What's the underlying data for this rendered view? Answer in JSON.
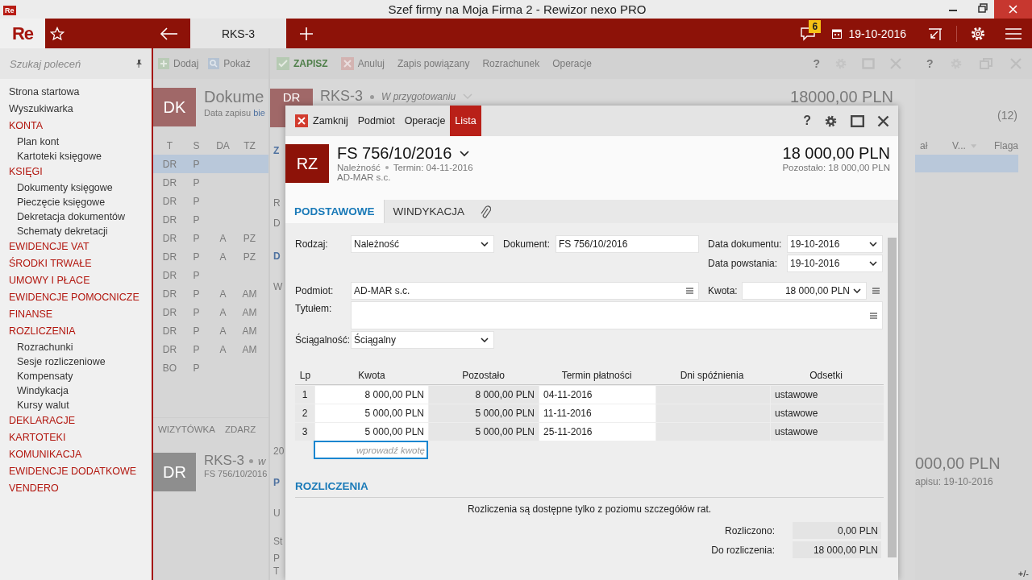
{
  "window": {
    "icon": "Re",
    "title": "Szef firmy na Moja Firma 2 - Rewizor nexo PRO"
  },
  "app_bar": {
    "logo": "Re",
    "tabs": [
      {
        "label": "RKS-3",
        "selected": true
      }
    ],
    "notifications": "6",
    "date": "19-10-2016"
  },
  "sidebar": {
    "search": {
      "placeholder": "Szukaj poleceń"
    },
    "items": [
      {
        "label": "Strona startowa",
        "kind": "link"
      },
      {
        "label": "Wyszukiwarka",
        "kind": "link"
      },
      {
        "label": "KONTA",
        "kind": "section",
        "children": [
          {
            "label": "Plan kont"
          },
          {
            "label": "Kartoteki księgowe"
          }
        ]
      },
      {
        "label": "KSIĘGI",
        "kind": "section",
        "children": [
          {
            "label": "Dokumenty księgowe"
          },
          {
            "label": "Pieczęcie księgowe"
          },
          {
            "label": "Dekretacja dokumentów"
          },
          {
            "label": "Schematy dekretacji"
          }
        ]
      },
      {
        "label": "EWIDENCJE VAT",
        "kind": "section"
      },
      {
        "label": "ŚRODKI TRWAŁE",
        "kind": "section"
      },
      {
        "label": "UMOWY I PŁACE",
        "kind": "section"
      },
      {
        "label": "EWIDENCJE POMOCNICZE",
        "kind": "section"
      },
      {
        "label": "FINANSE",
        "kind": "section"
      },
      {
        "label": "ROZLICZENIA",
        "kind": "section",
        "children": [
          {
            "label": "Rozrachunki"
          },
          {
            "label": "Sesje rozliczeniowe"
          },
          {
            "label": "Kompensaty"
          },
          {
            "label": "Windykacja"
          },
          {
            "label": "Kursy walut"
          }
        ]
      },
      {
        "label": "DEKLARACJE",
        "kind": "section"
      },
      {
        "label": "KARTOTEKI",
        "kind": "section"
      },
      {
        "label": "KOMUNIKACJA",
        "kind": "section"
      },
      {
        "label": "EWIDENCJE DODATKOWE",
        "kind": "section"
      },
      {
        "label": "VENDERO",
        "kind": "section"
      }
    ]
  },
  "document_list": {
    "toolbar": [
      {
        "label": "Dodaj",
        "kind": "add"
      },
      {
        "label": "Pokaż",
        "kind": "show"
      }
    ],
    "badge": "DK",
    "title": "Dokume",
    "subtitle": "Data zapisu",
    "subtitle_link": "bie",
    "columns": [
      "T",
      "S",
      "DA",
      "TZ"
    ],
    "rows": [
      {
        "t": "DR",
        "s": "P",
        "selected": true
      },
      {
        "t": "DR",
        "s": "P",
        "selected": false
      },
      {
        "t": "DR",
        "s": "P",
        "selected": false
      },
      {
        "t": "DR",
        "s": "P",
        "selected": false
      },
      {
        "t": "DR",
        "s": "P",
        "da": "A",
        "tz": "PZ",
        "selected": false
      },
      {
        "t": "DR",
        "s": "P",
        "da": "A",
        "tz": "PZ",
        "selected": false
      },
      {
        "t": "DR",
        "s": "P",
        "selected": false
      },
      {
        "t": "DR",
        "s": "P",
        "da": "A",
        "tz": "AM",
        "selected": false
      },
      {
        "t": "DR",
        "s": "P",
        "da": "A",
        "tz": "AM",
        "selected": false
      },
      {
        "t": "DR",
        "s": "P",
        "da": "A",
        "tz": "AM",
        "selected": false
      },
      {
        "t": "DR",
        "s": "P",
        "da": "A",
        "tz": "AM",
        "selected": false
      },
      {
        "t": "BO",
        "s": "P",
        "selected": false
      }
    ],
    "tabs": [
      "WIZYTÓWKA",
      "ZDARZ"
    ],
    "card": {
      "badge": "DR",
      "title": "RKS-3",
      "status": "w",
      "subtitle": "FS 756/10/2016"
    }
  },
  "document_editor": {
    "toolbar": [
      {
        "label": "ZAPISZ",
        "kind": "save"
      },
      {
        "label": "Anuluj",
        "kind": "cancel"
      },
      {
        "label": "Zapis powiązany",
        "kind": "text"
      },
      {
        "label": "Rozrachunek",
        "kind": "text"
      },
      {
        "label": "Operacje",
        "kind": "text"
      }
    ],
    "help": "?",
    "badge": "DR",
    "title": "RKS-3",
    "status": "W przygotowaniu",
    "amount": "18000,00 PLN",
    "edge_texts": [
      "Z",
      "R",
      "D",
      "D",
      "W",
      "20",
      "P",
      "U",
      "St",
      "P",
      "T"
    ]
  },
  "right_pane": {
    "help": "?",
    "count": "(12)",
    "columns": [
      "ał",
      "V...",
      "Flaga"
    ],
    "amount": "000,00 PLN",
    "date_line": "apisu: 19-10-2016",
    "toggle": "+/-"
  },
  "dialog": {
    "toolbar": [
      {
        "label": "Zamknij",
        "kind": "close",
        "selected": false
      },
      {
        "label": "Podmiot",
        "kind": "text",
        "selected": false
      },
      {
        "label": "Operacje",
        "kind": "text",
        "selected": false
      },
      {
        "label": "Lista",
        "kind": "text",
        "selected": true
      }
    ],
    "help": "?",
    "badge": "RZ",
    "title": "FS 756/10/2016",
    "kind_label": "Należność",
    "due": "Termin: 04-11-2016",
    "party": "AD-MAR s.c.",
    "amount": "18 000,00 PLN",
    "remaining": "Pozostało: 18 000,00 PLN",
    "tabs": [
      {
        "label": "PODSTAWOWE",
        "selected": true
      },
      {
        "label": "WINDYKACJA",
        "selected": false
      }
    ],
    "form": {
      "rodzaj": {
        "label": "Rodzaj:",
        "value": "Należność"
      },
      "dokument": {
        "label": "Dokument:",
        "value": "FS 756/10/2016"
      },
      "data_dokumentu": {
        "label": "Data dokumentu:",
        "value": "19-10-2016"
      },
      "data_powstania": {
        "label": "Data powstania:",
        "value": "19-10-2016"
      },
      "podmiot": {
        "label": "Podmiot:",
        "value": "AD-MAR s.c."
      },
      "kwota": {
        "label": "Kwota:",
        "value": "18 000,00 PLN"
      },
      "tytulem": {
        "label": "Tytułem:"
      },
      "sciagalnosc": {
        "label": "Ściągalność:",
        "value": "Ściągalny"
      }
    },
    "installments": {
      "columns": [
        "Lp",
        "Kwota",
        "Pozostało",
        "Termin płatności",
        "Dni spóźnienia",
        "Odsetki"
      ],
      "rows": [
        {
          "lp": "1",
          "kwota": "8 000,00 PLN",
          "pozostalo": "8 000,00 PLN",
          "termin": "04-11-2016",
          "odsetki": "ustawowe"
        },
        {
          "lp": "2",
          "kwota": "5 000,00 PLN",
          "pozostalo": "5 000,00 PLN",
          "termin": "11-11-2016",
          "odsetki": "ustawowe"
        },
        {
          "lp": "3",
          "kwota": "5 000,00 PLN",
          "pozostalo": "5 000,00 PLN",
          "termin": "25-11-2016",
          "odsetki": "ustawowe"
        }
      ],
      "new_row": {
        "placeholder": "wprowadź kwotę"
      }
    },
    "settlements": {
      "title": "ROZLICZENIA",
      "note": "Rozliczenia są dostępne tylko z poziomu szczegółów rat.",
      "totals": [
        {
          "label": "Rozliczono:",
          "value": "0,00 PLN"
        },
        {
          "label": "Do rozliczenia:",
          "value": "18 000,00 PLN"
        }
      ]
    }
  }
}
